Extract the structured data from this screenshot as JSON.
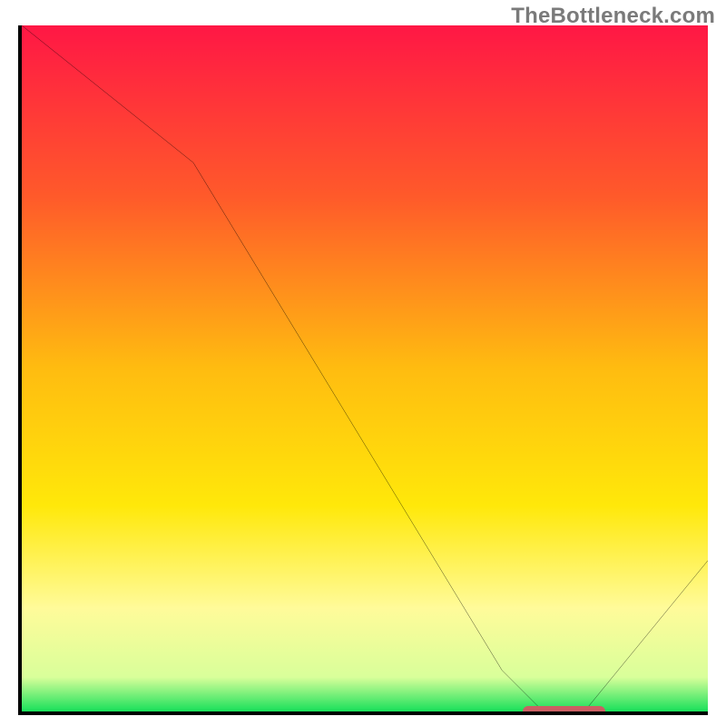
{
  "watermark": "TheBottleneck.com",
  "chart_data": {
    "type": "line",
    "title": "",
    "xlabel": "",
    "ylabel": "",
    "xlim": [
      0,
      100
    ],
    "ylim": [
      0,
      100
    ],
    "x": [
      0,
      25,
      70,
      76,
      82,
      100
    ],
    "values": [
      100,
      80,
      6,
      0,
      0,
      22
    ],
    "marker": {
      "x_start": 73,
      "x_end": 85,
      "y": 0
    },
    "gradient_stops": [
      {
        "pos": 0,
        "color": "#ff1745"
      },
      {
        "pos": 25,
        "color": "#ff5a2a"
      },
      {
        "pos": 50,
        "color": "#ffbc10"
      },
      {
        "pos": 70,
        "color": "#ffe80a"
      },
      {
        "pos": 85,
        "color": "#fffb9a"
      },
      {
        "pos": 95,
        "color": "#d9ff9a"
      },
      {
        "pos": 100,
        "color": "#18e05a"
      }
    ],
    "curve_color": "#000000",
    "axis_color": "#000000"
  }
}
